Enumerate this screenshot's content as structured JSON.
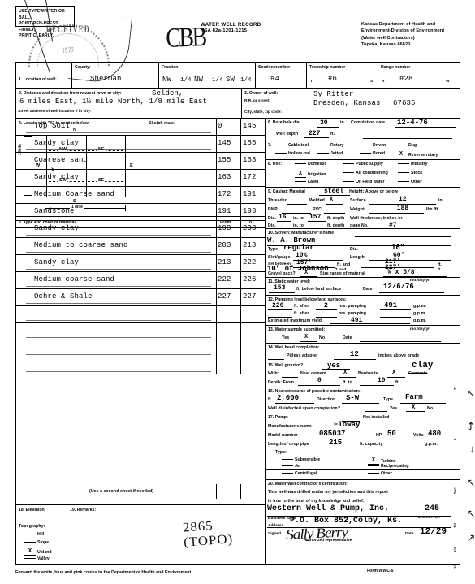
{
  "instructions": {
    "l1": "USE TYPEWRITER OR BALL",
    "l2": "POINT PEN-PRESS FIRMLY,",
    "l3": "PRINT CLEARLY."
  },
  "header": {
    "title": "WATER WELL RECORD",
    "statute": "KSA 82a-1201-1215",
    "agency_l1": "Kansas Department of Health and",
    "agency_l2": "Environment-Division of Environment",
    "agency_l3": "(Water well Contractors)",
    "agency_l4": "Topeka, Kansas 66620",
    "hand_initials": "CBB",
    "stamp_text": "RECEIVED",
    "stamp_text2": "1977"
  },
  "location": {
    "label": "1. Location of well:",
    "county_label": "County:",
    "county_value": "Sherman",
    "fraction_label": "Fraction",
    "fraction_q1": "NW",
    "fraction_q2": "NW",
    "fraction_q3": "SW",
    "quarter": "1/4",
    "section_label": "Section number",
    "section_value": "#4",
    "township_label": "Township number",
    "township_prefix": "T",
    "township_value": "#6",
    "township_suffix": "S",
    "range_label": "Range number",
    "range_prefix": "R",
    "range_value": "#28",
    "range_suffix": "W"
  },
  "distance": {
    "label": "2. Distance and direction from nearest town or city:",
    "town": "Selden,",
    "value": "6 miles East, 1½ mile North, 1/8 mile East",
    "street_label": "Street address of well location if in city:"
  },
  "owner": {
    "label": "3. Owner of well:",
    "name": "Sy Ritter",
    "rr_label": "R.R. or street:",
    "address": "Dresden, Kansas",
    "zip": "67635",
    "city_label": "City, state, zip code:"
  },
  "section4": {
    "label": "4. Locate with \"X\" in section below:",
    "sketch_label": "Sketch map:",
    "n": "N",
    "s": "S",
    "e": "E",
    "w": "W",
    "nw": "NW",
    "ne": "NE",
    "sw": "SW",
    "se": "SE",
    "mark": "X",
    "scale_v": "1 Mile",
    "scale_h": "1 Mile"
  },
  "materials": {
    "header": "5. Type and color of material",
    "col_from": "From",
    "col_to": "To",
    "note": "(Use a second sheet if needed)",
    "rows": [
      {
        "desc": "Top Soil",
        "from": "0",
        "to": "145"
      },
      {
        "desc": "Sandy clay",
        "from": "145",
        "to": "155"
      },
      {
        "desc": "Coarese sand",
        "from": "155",
        "to": "163"
      },
      {
        "desc": "Sandy clay",
        "from": "163",
        "to": "172"
      },
      {
        "desc": "Medium Coarse sand",
        "from": "172",
        "to": "191"
      },
      {
        "desc": "Sandstone",
        "from": "191",
        "to": "193"
      },
      {
        "desc": "Sandy clay",
        "from": "193",
        "to": "203"
      },
      {
        "desc": "Medium to coarse sand",
        "from": "203",
        "to": "213"
      },
      {
        "desc": "Sandy clay",
        "from": "213",
        "to": "222"
      },
      {
        "desc": "Medium coarse sand",
        "from": "222",
        "to": "226"
      },
      {
        "desc": "Ochre & Shale",
        "from": "227",
        "to": "227"
      },
      {
        "desc": "",
        "from": "",
        "to": ""
      },
      {
        "desc": "",
        "from": "",
        "to": ""
      },
      {
        "desc": "",
        "from": "",
        "to": ""
      },
      {
        "desc": "",
        "from": "",
        "to": ""
      }
    ]
  },
  "sec6": {
    "label": "6. Bore hole dia.",
    "dia_value": "30",
    "dia_unit": "in.",
    "completion_label": "Completion date",
    "completion_value": "12-4-76",
    "depth_label": "Well depth",
    "depth_value": "227",
    "depth_unit": "ft."
  },
  "sec7": {
    "label": "7.",
    "opts_row1": [
      "Cable tool",
      "Rotary",
      "Driven",
      "Dug"
    ],
    "opts_row2": [
      "Hollow rod",
      "Jetted",
      "Bored",
      "Reverse rotary"
    ],
    "checked": "Reverse rotary",
    "mark": "X"
  },
  "sec8": {
    "label": "8. Use:",
    "opts_row1": [
      "Domestic",
      "Public supply",
      "Industry"
    ],
    "opts_row2": [
      "Irrigation",
      "Air conditioning",
      "Stock"
    ],
    "opts_row3": [
      "Lawn",
      "Oil Field water",
      "Other"
    ],
    "checked": "Irrigation",
    "mark": "X"
  },
  "sec9": {
    "label": "9. Casing:  Material",
    "material": "steel",
    "height_label": "Height: Above or below",
    "threaded_label": "Threaded",
    "welded_label": "Welded",
    "welded_mark": "X",
    "surface_label": "Surface",
    "surface_value": "12",
    "surface_unit": "in.",
    "rmp_label": "RMP",
    "pvc_label": "PVC",
    "weight_label": "Weight",
    "weight_value": ".188",
    "weight_unit": "lbs./ft.",
    "dia_label": "Dia.",
    "dia_value": "16",
    "dia_to_label": "in. to",
    "depth_value": "157",
    "depth_unit": "ft. depth",
    "wall_label": "Wall thickness; inches or",
    "gauge_label": "gage No.",
    "gauge_value": "#7",
    "dia2_label": "Dia.",
    "dia2_unit": "in. to",
    "depth2_unit": "ft. depth"
  },
  "sec10": {
    "label": "10. Screen:  Manufacturer's name",
    "manufacturer": "W. A. Brown",
    "type_label": "Type",
    "type_value": "regular",
    "dia_label": "Dia.",
    "dia_value": "16\"",
    "slot_label": "Slot/gauge",
    "slot_value": "10%",
    "length_label": "Length",
    "length_value": "60'",
    "set_label": "Set between",
    "set_from": "157'",
    "set_mid": "ft. and",
    "set_to": "217'",
    "set_unit": "ft.",
    "set2_from": "10\" of Johnson",
    "set2_to": "227'",
    "gravel_label": "Gravel pack?",
    "gravel_mark": "X",
    "gravel_size_label": "Size range of material",
    "gravel_size": "¼ x 5/8"
  },
  "sec11": {
    "label": "11. Static water level:",
    "value": "153",
    "unit": "ft. below land surface",
    "date_label": "Date",
    "date_value": "12/6/76",
    "mdy": "mo./day/yr."
  },
  "sec12": {
    "label": "12. Pumping level below land surfaces:",
    "row1_depth": "226",
    "row1_hrs": "2",
    "row1_gpm": "491",
    "row2_depth": "",
    "row2_hrs": "",
    "row2_gpm": "",
    "ft_after": "ft. after",
    "hrs_pumping": "hrs. pumping",
    "gpm": "g.p.m.",
    "yield_label": "Estimated maximum yield",
    "yield_value": "491"
  },
  "sec13": {
    "label": "13. Water sample submitted:",
    "yes": "Yes",
    "no": "No",
    "mark": "X",
    "checked": "No",
    "date_label": "Date",
    "mdy": "mo./day/yr."
  },
  "sec14": {
    "label": "14. Well head completion:",
    "pitless_label": "Pitless adapter",
    "value": "12",
    "unit": "inches above grade"
  },
  "sec15": {
    "label": "15. Well grouted?",
    "grouted_value": "yes",
    "with_label": "With:",
    "neat_cement": "Neat cement",
    "bentonite": "Bentonite",
    "concrete": "Concrete",
    "concrete_override": "clay",
    "neat_mark": "X",
    "bent_mark": "X",
    "depth_label": "Depth: From",
    "depth_from": "0",
    "depth_mid": "ft. to",
    "depth_to": "10",
    "depth_unit": "ft."
  },
  "sec16": {
    "label": "16. Nearest source of possible contamination:",
    "ft_label": "ft.",
    "ft_value": "2,000",
    "dir_label": "Direction",
    "dir_value": "S-W",
    "type_label": "Type",
    "type_value": "Farm",
    "disinfect_label": "Well disinfected upon completion?",
    "yes": "Yes",
    "no": "No",
    "mark": "X",
    "checked": "No"
  },
  "sec17": {
    "label": "17. Pump:",
    "not_installed": "Not installed",
    "mfr_label": "Manufacturer's name",
    "mfr_value": "Floway",
    "model_label": "Model number",
    "model_value": "085037",
    "hp_label": "HP",
    "hp_value": "50",
    "volts_label": "Volts",
    "volts_value": "480",
    "drop_label": "Length of drop pipe",
    "drop_value": "215",
    "drop_unit": "ft. capacity",
    "gpm": "g.p.m.",
    "type_label": "Type:",
    "opts_left": [
      "Submersible",
      "Jet",
      "Centrifugal"
    ],
    "opts_right": [
      "Turbine",
      "Reciprocating",
      "Other"
    ],
    "checked": "Turbine",
    "mark": "X"
  },
  "sec18": {
    "label": "18. Elevation:",
    "topography_label": "Topography:",
    "opts": [
      "Hill",
      "Slope",
      "Upland",
      "Valley"
    ],
    "checked": "Upland",
    "mark": "X"
  },
  "sec19": {
    "label": "19. Remarks:",
    "hand_note": "2865 (TOPO)"
  },
  "sec20": {
    "label": "20. Water well contractor's certification:",
    "l1": "This well was drilled under my jurisdiction and this report",
    "l2": "is true to the best of my knowledge and belief.",
    "business_name": "Western Well & Pump, Inc.",
    "license_no": "245",
    "business_label": "Business name",
    "license_label": "License No.",
    "address_label": "Address",
    "address_value": "P.O. Box 852,Colby, Ks.",
    "signed_label": "Signed",
    "signature": "Sally Berry",
    "authorized_label": "Authorized representative",
    "date_label": "Date",
    "date_value": "12/29"
  },
  "footer": {
    "text": "Forward the white, blue and pink copies to the Department of Health and Environment",
    "form_no": "Form WWC-5"
  },
  "margin_notes": {
    "n1": "7",
    "n2": "8",
    "n3": "Sec",
    "n4": "1/4",
    "n5": "1/4",
    "n6": "1/4"
  }
}
